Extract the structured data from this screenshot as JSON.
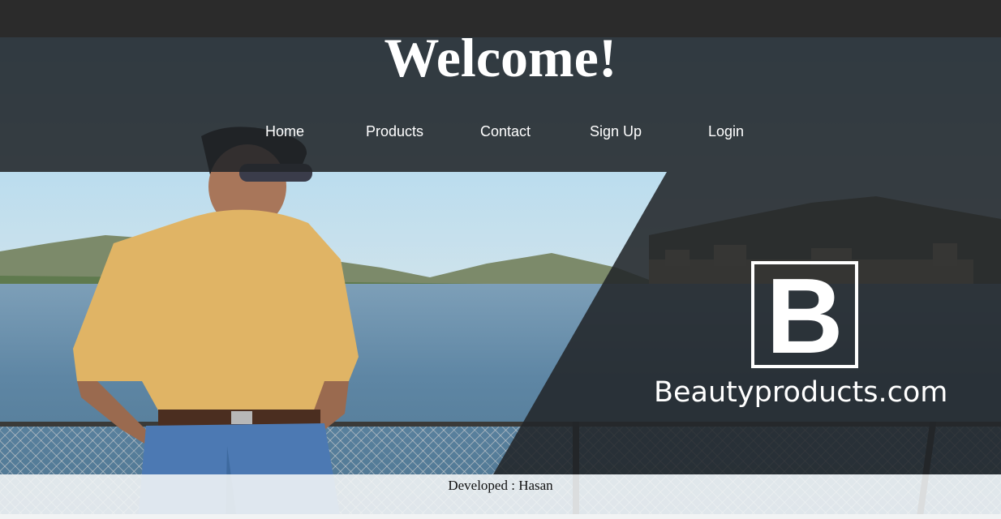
{
  "header": {
    "title": "Welcome!"
  },
  "nav": {
    "items": [
      {
        "label": "Home"
      },
      {
        "label": "Products"
      },
      {
        "label": "Contact"
      },
      {
        "label": "Sign Up"
      },
      {
        "label": "Login"
      }
    ]
  },
  "brand": {
    "logo_letter": "B",
    "name": "Beautyproducts.com"
  },
  "footer": {
    "credit": "Developed : Hasan"
  },
  "colors": {
    "overlay": "#222629",
    "text_light": "#ffffff",
    "footer_bg": "#f4f6f7"
  }
}
